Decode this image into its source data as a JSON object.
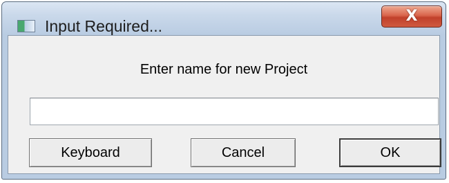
{
  "window": {
    "title": "Input Required...",
    "close_label": "X"
  },
  "dialog": {
    "prompt": "Enter name for new Project",
    "input_value": "",
    "input_placeholder": ""
  },
  "buttons": {
    "keyboard": "Keyboard",
    "cancel": "Cancel",
    "ok": "OK"
  },
  "icons": {
    "app": "app-window-icon",
    "close": "close-icon"
  },
  "colors": {
    "titlebar": "#c9d8ea",
    "close_button": "#c1412b",
    "client_background": "#f0f0f0"
  }
}
